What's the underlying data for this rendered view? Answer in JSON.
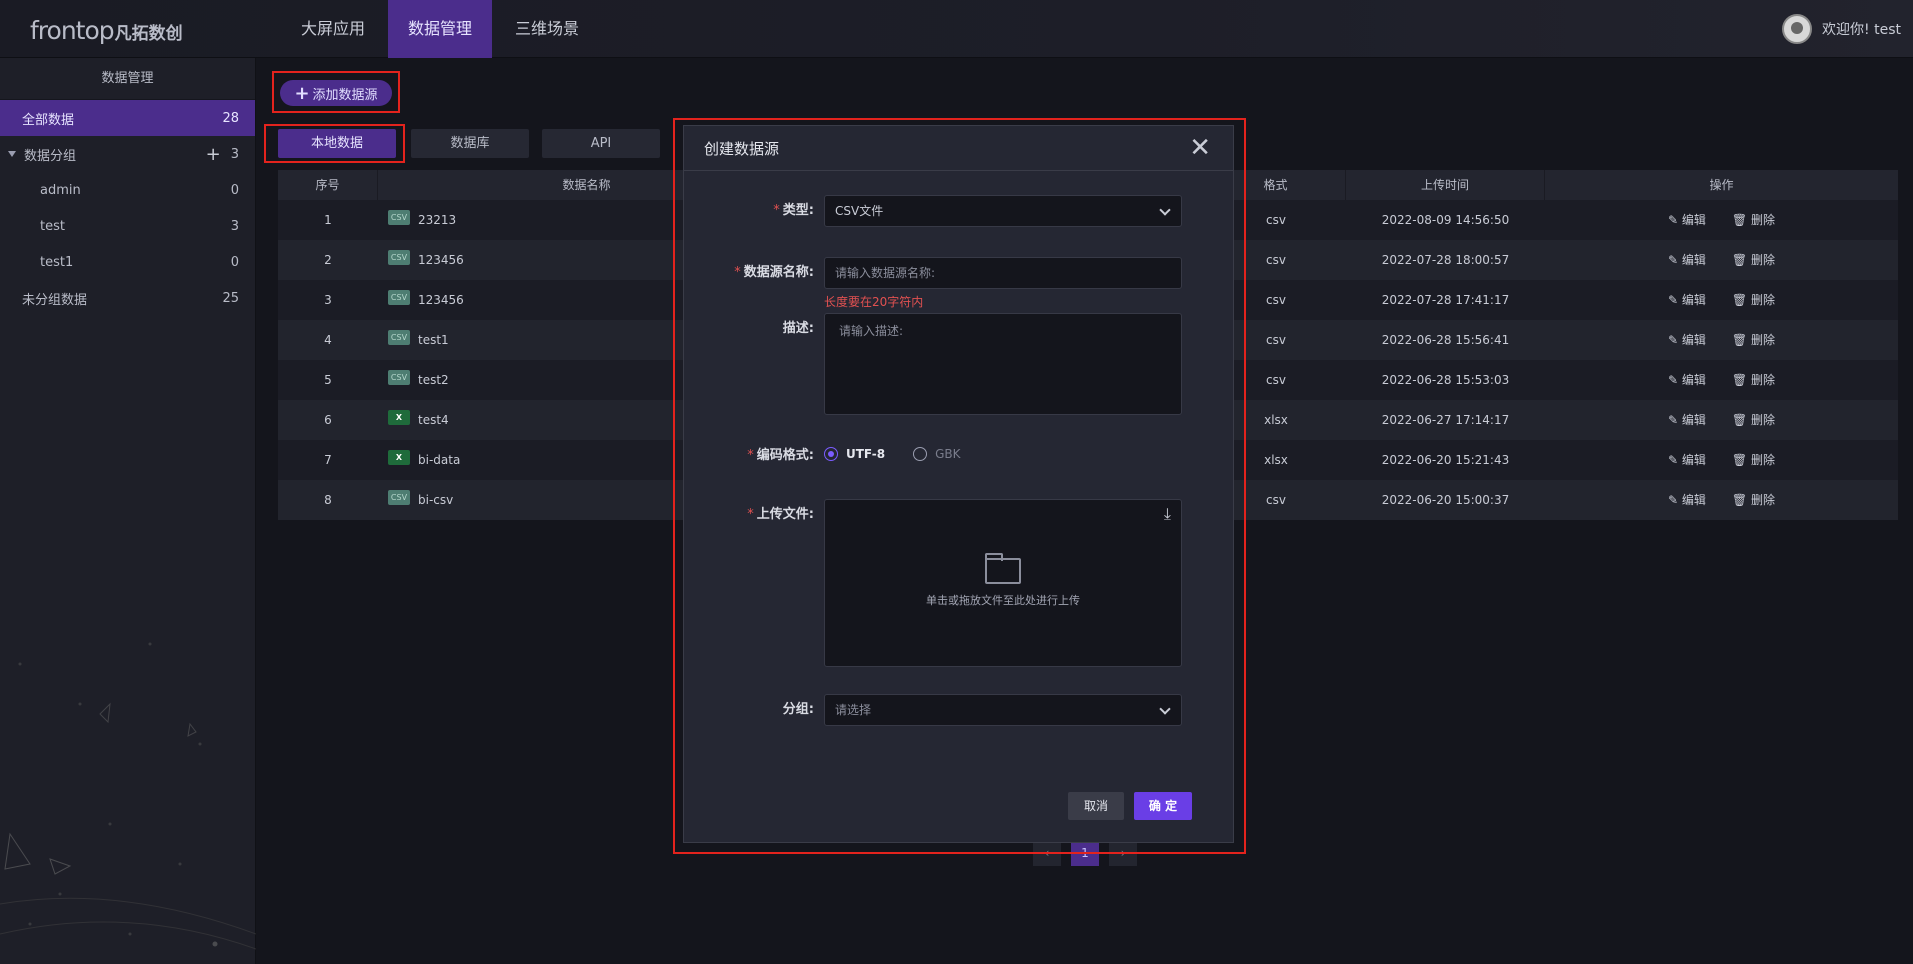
{
  "app": {
    "logo_en": "frontop",
    "logo_cn": "凡拓数创",
    "nav": [
      "大屏应用",
      "数据管理",
      "三维场景"
    ],
    "active_nav": "数据管理",
    "welcome": "欢迎你! test"
  },
  "sidebar": {
    "title": "数据管理",
    "all": {
      "label": "全部数据",
      "count": "28"
    },
    "group": {
      "label": "数据分组",
      "count": "3"
    },
    "children": [
      {
        "label": "admin",
        "count": "0"
      },
      {
        "label": "test",
        "count": "3"
      },
      {
        "label": "test1",
        "count": "0"
      }
    ],
    "ungrouped": {
      "label": "未分组数据",
      "count": "25"
    }
  },
  "toolbar": {
    "add_label": "添加数据源"
  },
  "tabs": [
    "本地数据",
    "数据库",
    "API"
  ],
  "table": {
    "headers": [
      "序号",
      "数据名称",
      "格式",
      "上传时间",
      "操作"
    ],
    "edit_label": "编辑",
    "delete_label": "删除",
    "rows": [
      {
        "no": "1",
        "name": "23213",
        "icon": "CSV",
        "format": "csv",
        "time": "2022-08-09 14:56:50"
      },
      {
        "no": "2",
        "name": "123456",
        "icon": "CSV",
        "format": "csv",
        "time": "2022-07-28 18:00:57"
      },
      {
        "no": "3",
        "name": "123456",
        "icon": "CSV",
        "format": "csv",
        "time": "2022-07-28 17:41:17"
      },
      {
        "no": "4",
        "name": "test1",
        "icon": "CSV",
        "format": "csv",
        "time": "2022-06-28 15:56:41"
      },
      {
        "no": "5",
        "name": "test2",
        "icon": "CSV",
        "format": "csv",
        "time": "2022-06-28 15:53:03"
      },
      {
        "no": "6",
        "name": "test4",
        "icon": "X",
        "format": "xlsx",
        "time": "2022-06-27 17:14:17"
      },
      {
        "no": "7",
        "name": "bi-data",
        "icon": "X",
        "format": "xlsx",
        "time": "2022-06-20 15:21:43"
      },
      {
        "no": "8",
        "name": "bi-csv",
        "icon": "CSV",
        "format": "csv",
        "time": "2022-06-20 15:00:37"
      }
    ]
  },
  "pager": {
    "prev": "‹",
    "current": "1",
    "next": "›"
  },
  "modal": {
    "title": "创建数据源",
    "type_label": "类型:",
    "type_value": "CSV文件",
    "name_label": "数据源名称:",
    "name_placeholder": "请输入数据源名称:",
    "name_error": "长度要在20字符内",
    "desc_label": "描述:",
    "desc_placeholder": "请输入描述:",
    "encoding_label": "编码格式:",
    "encoding_options": [
      "UTF-8",
      "GBK"
    ],
    "encoding_selected": "UTF-8",
    "upload_label": "上传文件:",
    "upload_hint": "单击或拖放文件至此处进行上传",
    "group_label": "分组:",
    "group_placeholder": "请选择",
    "cancel": "取消",
    "ok": "确 定"
  },
  "colors": {
    "accent": "#4b2d8c",
    "primary_button": "#6a3ee6",
    "highlight": "#e3231d",
    "error": "#e25151"
  }
}
